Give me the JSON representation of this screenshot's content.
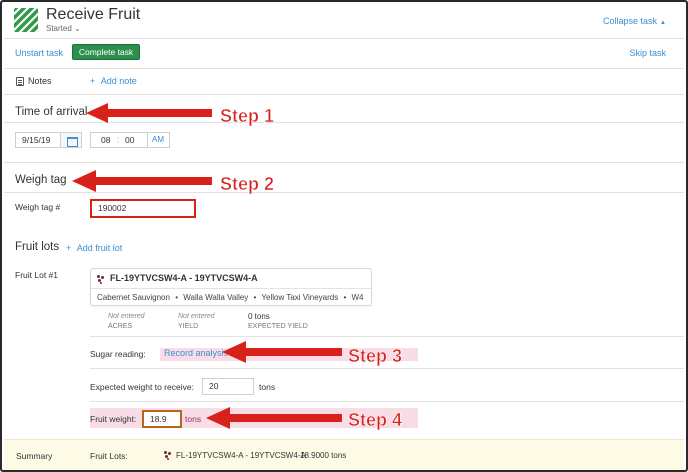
{
  "header": {
    "title": "Receive Fruit",
    "status": "Started",
    "status_caret": "⌄",
    "collapse_label": "Collapse task",
    "collapse_caret": "▲"
  },
  "toolbar": {
    "unstart_label": "Unstart task",
    "complete_label": "Complete task",
    "skip_label": "Skip task"
  },
  "notes": {
    "label": "Notes",
    "add_label": "Add note"
  },
  "time_of_arrival": {
    "title": "Time of arrival",
    "date": "9/15/19",
    "hour": "08",
    "separator": ":",
    "minute": "00",
    "ampm": "AM"
  },
  "weigh_tag": {
    "title": "Weigh tag",
    "field_label": "Weigh tag #",
    "value": "190002"
  },
  "fruit_lots": {
    "title": "Fruit lots",
    "add_label": "Add fruit lot",
    "lot_label": "Fruit Lot #1",
    "lot_code": "FL-19YTVCSW4-A - 19YTVCSW4-A",
    "lot_variety": "Cabernet Sauvignon",
    "lot_region": "Walla Walla Valley",
    "lot_vineyard": "Yellow Taxi Vineyards",
    "lot_block": "W4",
    "bullet": "•",
    "acres_value": "Not entered",
    "acres_label": "ACRES",
    "yield_value": "Not entered",
    "yield_label": "YIELD",
    "expected_value": "0 tons",
    "expected_label": "EXPECTED YIELD",
    "sugar_label": "Sugar reading:",
    "record_analysis": "Record analysis",
    "expected_weight_label": "Expected weight to receive:",
    "expected_weight_value": "20",
    "expected_weight_unit": "tons",
    "fruit_weight_label": "Fruit weight:",
    "fruit_weight_value": "18.9",
    "fruit_weight_unit": "tons"
  },
  "summary": {
    "label": "Summary",
    "lots_label": "Fruit Lots:",
    "lot_code": "FL-19YTVCSW4-A - 19YTVCSW4-A",
    "lot_weight": "18.9000 tons"
  },
  "annotations": {
    "step1": "Step 1",
    "step2": "Step 2",
    "step3": "Step 3",
    "step4": "Step 4"
  },
  "icons": {
    "add": "+",
    "notes": "notes-icon",
    "calendar": "calendar-icon",
    "lot": "grape-cluster-icon"
  },
  "colors": {
    "accent": "#3a8fd6",
    "primary_button": "#2d8f4e",
    "annotation": "#d8211a",
    "summary_bg": "#fdfbe6"
  }
}
